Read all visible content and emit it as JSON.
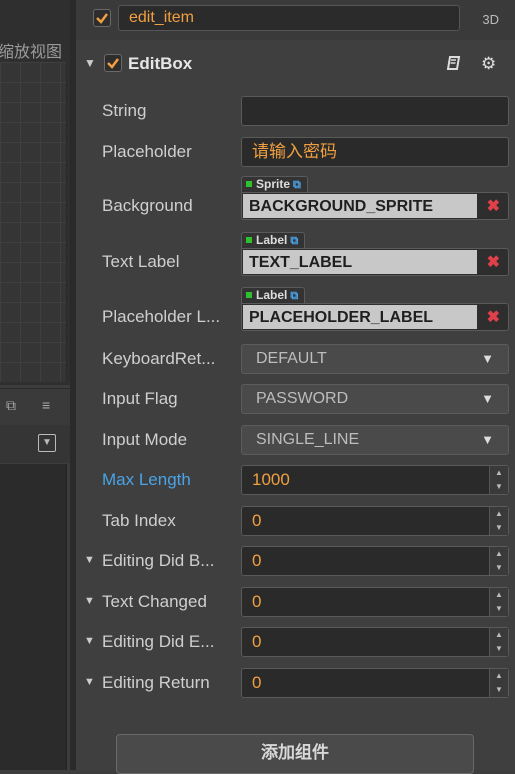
{
  "scene_panel": {
    "title": "缩放视图"
  },
  "node": {
    "name": "edit_item",
    "active": true,
    "badge": "3D"
  },
  "component": {
    "title": "EditBox",
    "enabled": true
  },
  "properties": {
    "string": {
      "label": "String",
      "value": ""
    },
    "placeholder": {
      "label": "Placeholder",
      "value": "请输入密码"
    },
    "background": {
      "label": "Background",
      "type_tag": "Sprite",
      "value": "BACKGROUND_SPRITE"
    },
    "text_label": {
      "label": "Text Label",
      "type_tag": "Label",
      "value": "TEXT_LABEL"
    },
    "placeholder_label": {
      "label": "Placeholder L...",
      "type_tag": "Label",
      "value": "PLACEHOLDER_LABEL"
    },
    "keyboard_return": {
      "label": "KeyboardRet...",
      "value": "DEFAULT"
    },
    "input_flag": {
      "label": "Input Flag",
      "value": "PASSWORD"
    },
    "input_mode": {
      "label": "Input Mode",
      "value": "SINGLE_LINE"
    },
    "max_length": {
      "label": "Max Length",
      "value": "1000"
    },
    "tab_index": {
      "label": "Tab Index",
      "value": "0"
    },
    "editing_did_begin": {
      "label": "Editing Did B...",
      "value": "0"
    },
    "text_changed": {
      "label": "Text Changed",
      "value": "0"
    },
    "editing_did_end": {
      "label": "Editing Did E...",
      "value": "0"
    },
    "editing_return": {
      "label": "Editing Return",
      "value": "0"
    }
  },
  "add_component_label": "添加组件",
  "colors": {
    "accent": "#f0a040",
    "link": "#4aa3e6",
    "remove": "#e0404a"
  }
}
